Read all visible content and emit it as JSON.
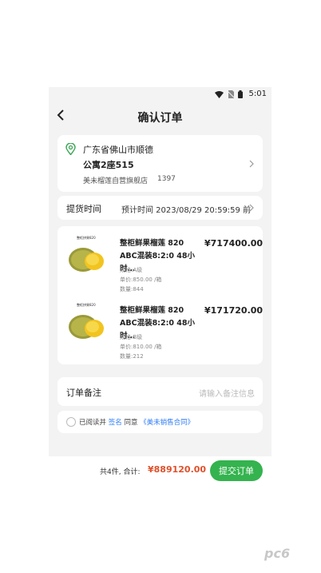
{
  "status": {
    "time": "5:01"
  },
  "header": {
    "title": "确认订单",
    "back_icon": "chevron-left-icon"
  },
  "address": {
    "line1": "广东省佛山市顺德",
    "line2": "公寓2座515",
    "store": "美未榴莲自营旗舰店",
    "phone": "1397",
    "icon": "location-pin-icon",
    "icon_color": "#3aa655"
  },
  "pickup": {
    "label": "提货时间",
    "value": "预计时间 2023/08/29 20:59:59 前"
  },
  "items": [
    {
      "thumb_tag": "整柜拼果820",
      "name": "整柜鲜果榴莲 820 ABC混装8:2:0 48小时…",
      "price": "¥717400.00",
      "spec": "规格:A级",
      "unit_price": "单价:850.00 /箱",
      "qty": "数量:844"
    },
    {
      "thumb_tag": "整柜拼果820",
      "name": "整柜鲜果榴莲 820 ABC混装8:2:0 48小时…",
      "price": "¥171720.00",
      "spec": "规格:B级",
      "unit_price": "单价:810.00 /箱",
      "qty": "数量:212"
    }
  ],
  "remark": {
    "label": "订单备注",
    "placeholder": "请输入备注信息"
  },
  "agreement": {
    "prefix": "已阅读并",
    "sign": "签名",
    "agree": "同意",
    "contract": "《美未销售合同》"
  },
  "footer": {
    "count": "共4件, 合计:",
    "total": "¥889120.00",
    "submit": "提交订单",
    "accent": "#34b34e",
    "price_color": "#e0502a"
  },
  "watermark": "pc6"
}
